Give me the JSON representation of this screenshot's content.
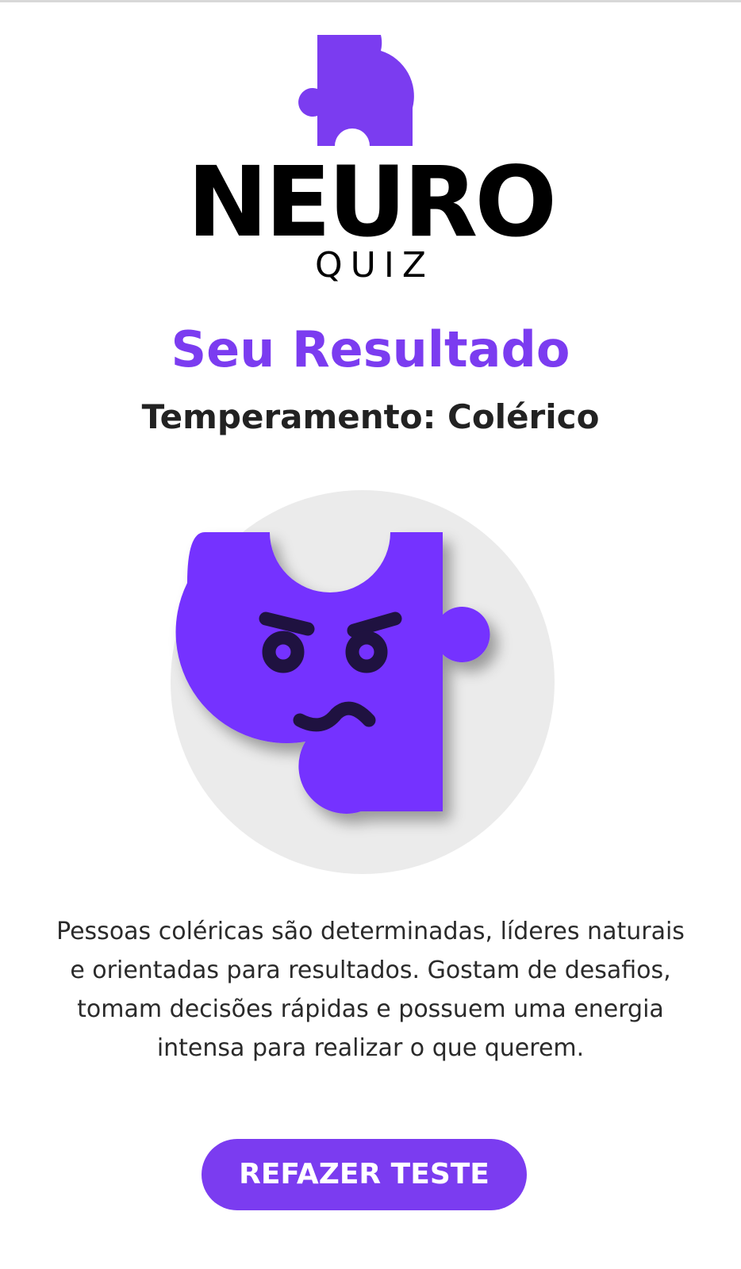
{
  "logo": {
    "title": "NEURO",
    "subtitle": "QUIZ",
    "icon": "puzzle-piece-icon"
  },
  "result": {
    "heading": "Seu Resultado",
    "temperament": "Temperamento: Colérico",
    "illustration_icon": "angry-puzzle-face-icon",
    "description": "Pessoas coléricas são determinadas, líderes naturais e orientadas para resultados. Gostam de desafios, tomam decisões rápidas e possuem uma energia intensa para realizar o que querem."
  },
  "actions": {
    "retry_label": "REFAZER TESTE"
  },
  "colors": {
    "accent": "#7b3cf0",
    "text_dark": "#222222",
    "circle_bg": "#ebebeb"
  }
}
